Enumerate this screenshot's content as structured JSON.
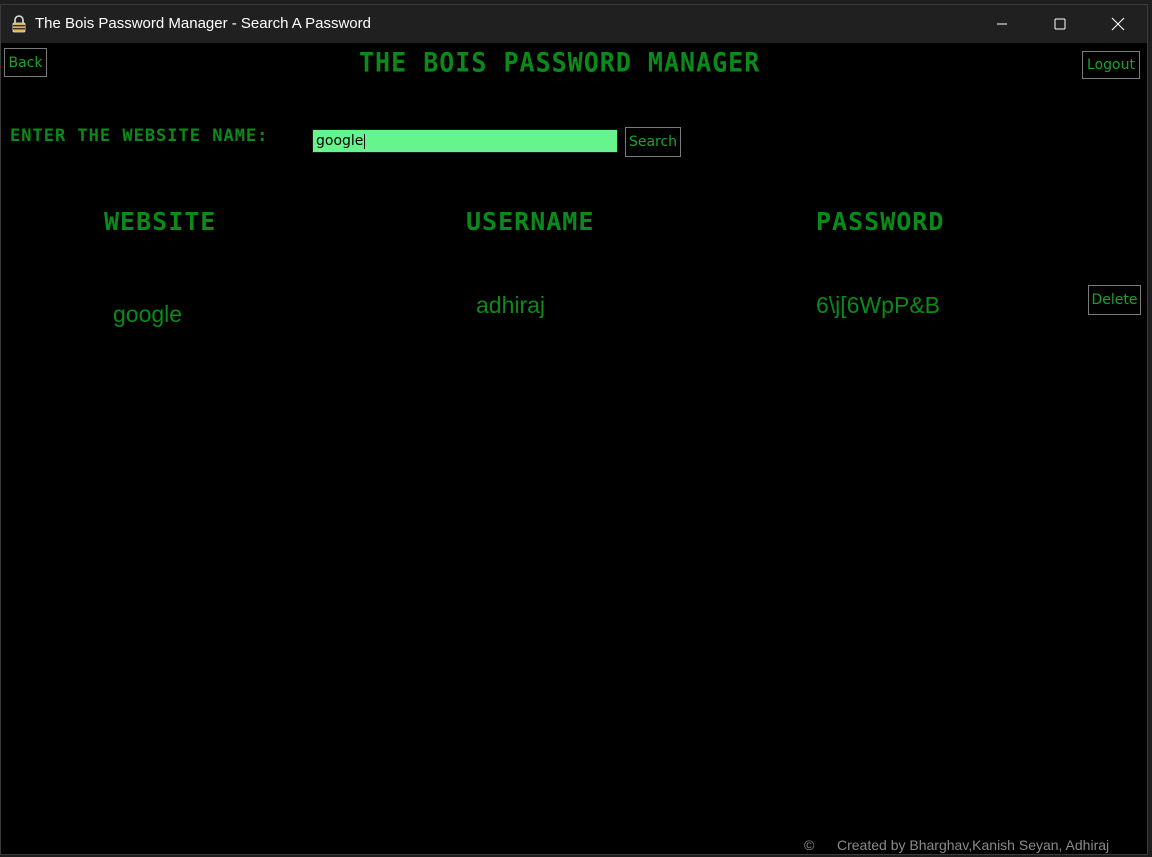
{
  "window": {
    "title": "The Bois Password Manager - Search A Password",
    "icon": "padlock-icon"
  },
  "colors": {
    "background": "#000000",
    "text_green": "#0a8a1a",
    "input_green": "#66f48c",
    "button_text": "#19a32b"
  },
  "header": {
    "app_title": "The Bois Password Manager",
    "back_label": "Back",
    "logout_label": "Logout"
  },
  "search": {
    "label": "Enter the website name:",
    "value": "google",
    "button_label": "Search"
  },
  "table": {
    "columns": [
      "Website",
      "Username",
      "Password"
    ],
    "rows": [
      {
        "website": "google",
        "username": "adhiraj",
        "password": "6\\j[6WpP&B",
        "delete_label": "Delete"
      }
    ]
  },
  "footer": {
    "copyright_symbol": "©",
    "credits": "Created by Bharghav,Kanish Seyan, Adhiraj"
  }
}
